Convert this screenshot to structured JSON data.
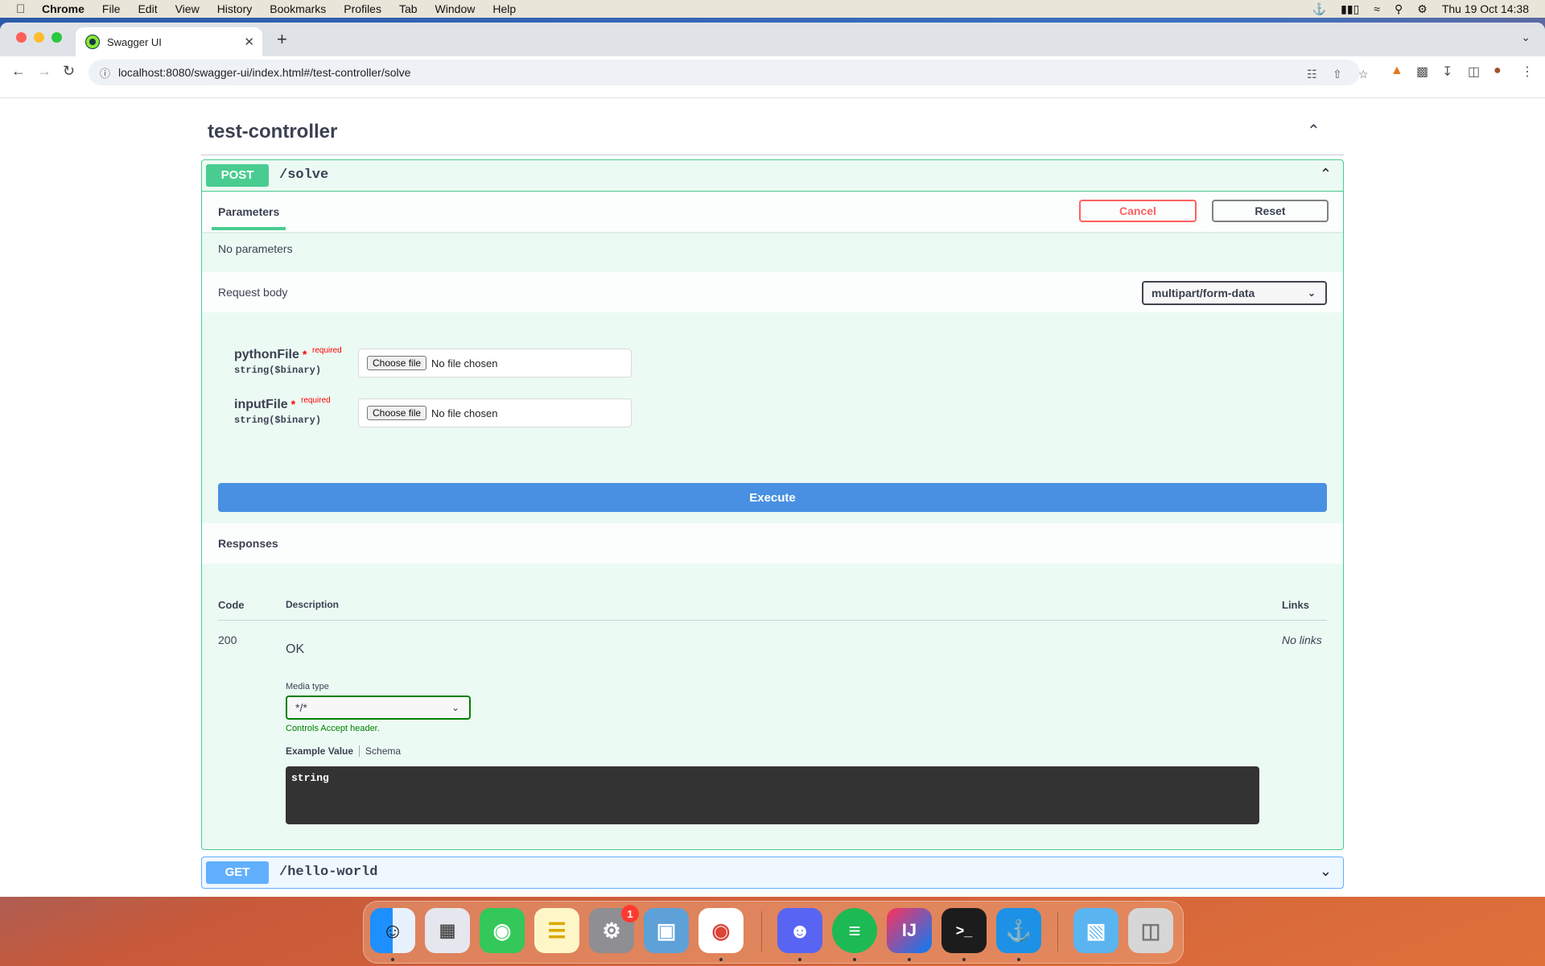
{
  "menubar": {
    "app": "Chrome",
    "items": [
      "File",
      "Edit",
      "View",
      "History",
      "Bookmarks",
      "Profiles",
      "Tab",
      "Window",
      "Help"
    ],
    "clock": "Thu 19 Oct  14:38"
  },
  "browser": {
    "tab_title": "Swagger UI",
    "url": "localhost:8080/swagger-ui/index.html#/test-controller/solve"
  },
  "swagger": {
    "tag": "test-controller",
    "operation": {
      "method": "POST",
      "path": "/solve",
      "parameters_tab": "Parameters",
      "cancel_label": "Cancel",
      "reset_label": "Reset",
      "no_parameters": "No parameters",
      "request_body_label": "Request body",
      "content_type": "multipart/form-data",
      "fields": [
        {
          "name": "pythonFile",
          "star": "*",
          "required": "required",
          "type": "string($binary)",
          "button": "Choose file",
          "status": "No file chosen"
        },
        {
          "name": "inputFile",
          "star": "*",
          "required": "required",
          "type": "string($binary)",
          "button": "Choose file",
          "status": "No file chosen"
        }
      ],
      "execute_label": "Execute",
      "responses_title": "Responses",
      "columns": {
        "code": "Code",
        "description": "Description",
        "links": "Links"
      },
      "response": {
        "code": "200",
        "description": "OK",
        "links": "No links",
        "media_type_label": "Media type",
        "media_type": "*/*",
        "controls_note": "Controls Accept header.",
        "example_tab": "Example Value",
        "schema_tab": "Schema",
        "example": "string"
      }
    },
    "next_operation": {
      "method": "GET",
      "path": "/hello-world"
    }
  },
  "dock": {
    "badge": "1"
  }
}
